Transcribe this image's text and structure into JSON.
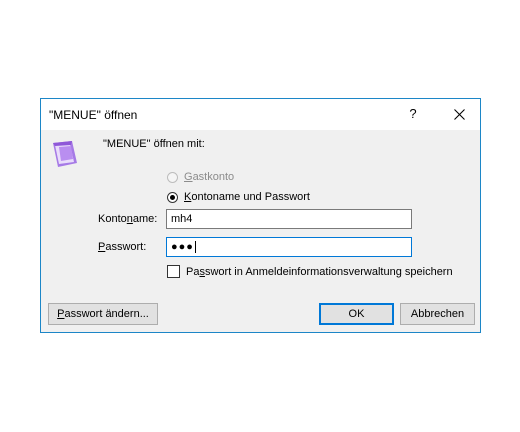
{
  "window": {
    "title": "\"MENUE\" öffnen",
    "help_glyph": "?",
    "close_icon": "close-icon"
  },
  "prompt": "\"MENUE\" öffnen mit:",
  "auth_options": {
    "guest": {
      "pre": "",
      "key": "G",
      "post": "astkonto",
      "enabled": false,
      "selected": false
    },
    "account": {
      "pre": "",
      "key": "K",
      "post": "ontoname und Passwort",
      "enabled": true,
      "selected": true
    }
  },
  "fields": {
    "account_label": {
      "pre": "Konto",
      "key": "n",
      "post": "ame:"
    },
    "account_value": "mh4",
    "password_label": {
      "pre": "",
      "key": "P",
      "post": "asswort:"
    },
    "password_mask": "●●●"
  },
  "save_checkbox": {
    "pre": "Pa",
    "key": "s",
    "post": "swort in Anmeldeinformationsverwaltung speichern",
    "checked": false
  },
  "buttons": {
    "change_password": {
      "pre": "",
      "key": "P",
      "post": "asswort ändern..."
    },
    "ok": "OK",
    "cancel": "Abbrechen"
  },
  "colors": {
    "accent": "#0078d7",
    "window_border": "#1c86c7",
    "dialog_bg": "#f0f0f0",
    "icon_purple": "#8f58d8"
  }
}
